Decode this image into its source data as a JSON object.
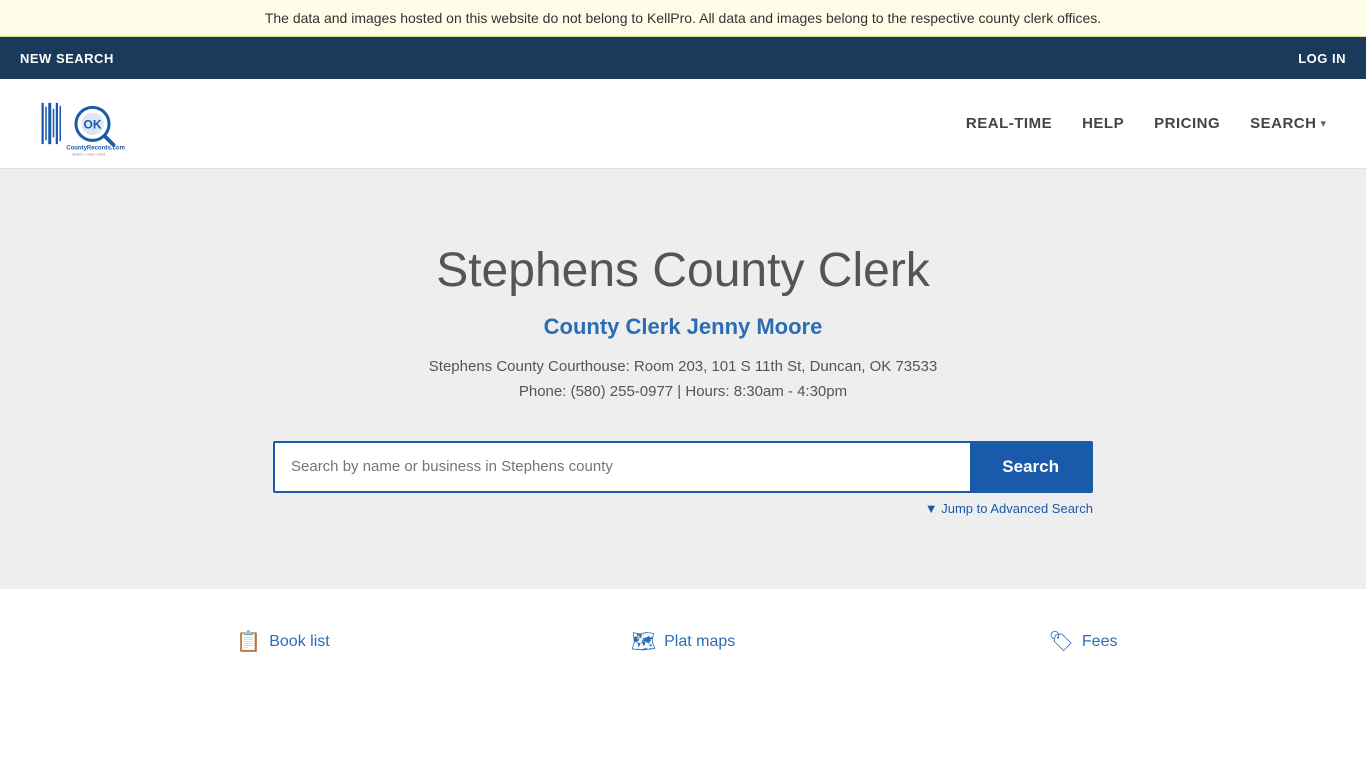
{
  "banner": {
    "text": "The data and images hosted on this website do not belong to KellPro. All data and images belong to the respective county clerk offices."
  },
  "top_nav": {
    "new_search_label": "NEW SEARCH",
    "log_in_label": "LOG IN"
  },
  "header": {
    "logo_alt": "OKCountyRecords.com",
    "nav_items": [
      {
        "id": "real-time",
        "label": "REAL-TIME"
      },
      {
        "id": "help",
        "label": "HELP"
      },
      {
        "id": "pricing",
        "label": "PRICING"
      },
      {
        "id": "search",
        "label": "SEARCH"
      }
    ]
  },
  "hero": {
    "title": "Stephens County Clerk",
    "clerk_name": "County Clerk Jenny Moore",
    "address_line1": "Stephens County Courthouse: Room 203, 101 S 11th St, Duncan, OK 73533",
    "address_line2": "Phone: (580) 255-0977 | Hours: 8:30am - 4:30pm",
    "search_placeholder": "Search by name or business in Stephens county",
    "search_button_label": "Search",
    "advanced_search_label": "▼ Jump to Advanced Search"
  },
  "footer_links": [
    {
      "id": "book-list",
      "icon": "📋",
      "label": "Book list"
    },
    {
      "id": "plat-maps",
      "icon": "🗺",
      "label": "Plat maps"
    },
    {
      "id": "fees",
      "icon": "🏷",
      "label": "Fees"
    }
  ]
}
